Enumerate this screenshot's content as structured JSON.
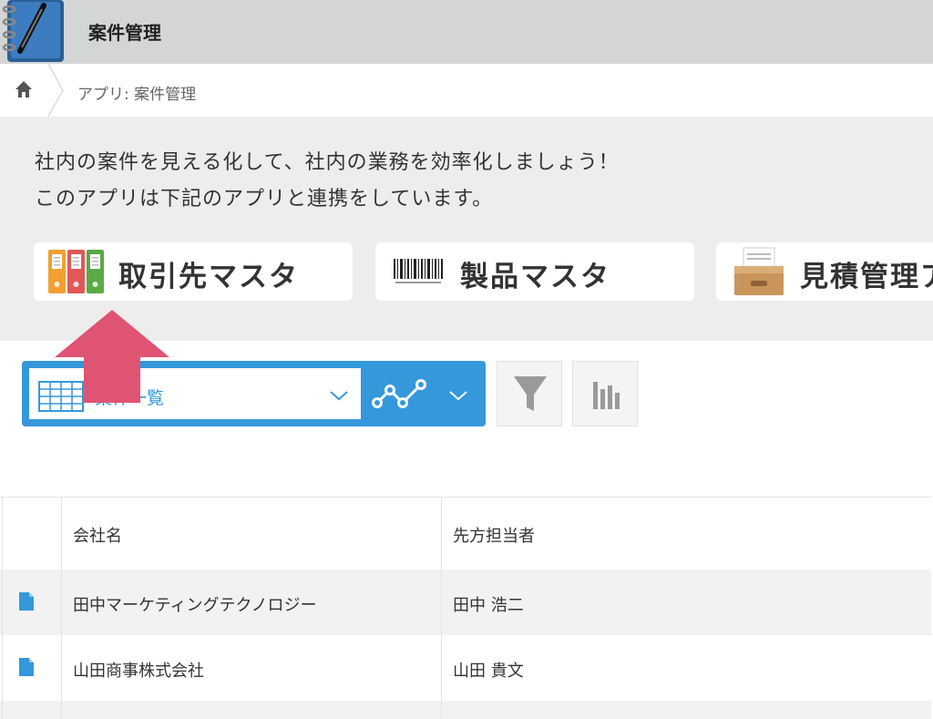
{
  "header": {
    "title": "案件管理"
  },
  "breadcrumb": {
    "text": "アプリ: 案件管理"
  },
  "description": {
    "line1": "社内の案件を見える化して、社内の業務を効率化しましょう！",
    "line2": "このアプリは下記のアプリと連携をしています。"
  },
  "linked_apps": [
    {
      "label": "取引先マスタ",
      "icon": "binders-icon"
    },
    {
      "label": "製品マスタ",
      "icon": "barcode-icon"
    },
    {
      "label": "見積管理ア",
      "icon": "file-tray-icon"
    }
  ],
  "toolbar": {
    "view_name": "案件一覧"
  },
  "table": {
    "columns": [
      "会社名",
      "先方担当者"
    ],
    "rows": [
      {
        "company": "田中マーケティングテクノロジー",
        "contact": "田中 浩二"
      },
      {
        "company": "山田商事株式会社",
        "contact": "山田 貴文"
      }
    ]
  },
  "colors": {
    "accent": "#3498db",
    "header_bg": "#d4d5d6",
    "desc_bg": "#ededed",
    "arrow": "#df5472"
  }
}
